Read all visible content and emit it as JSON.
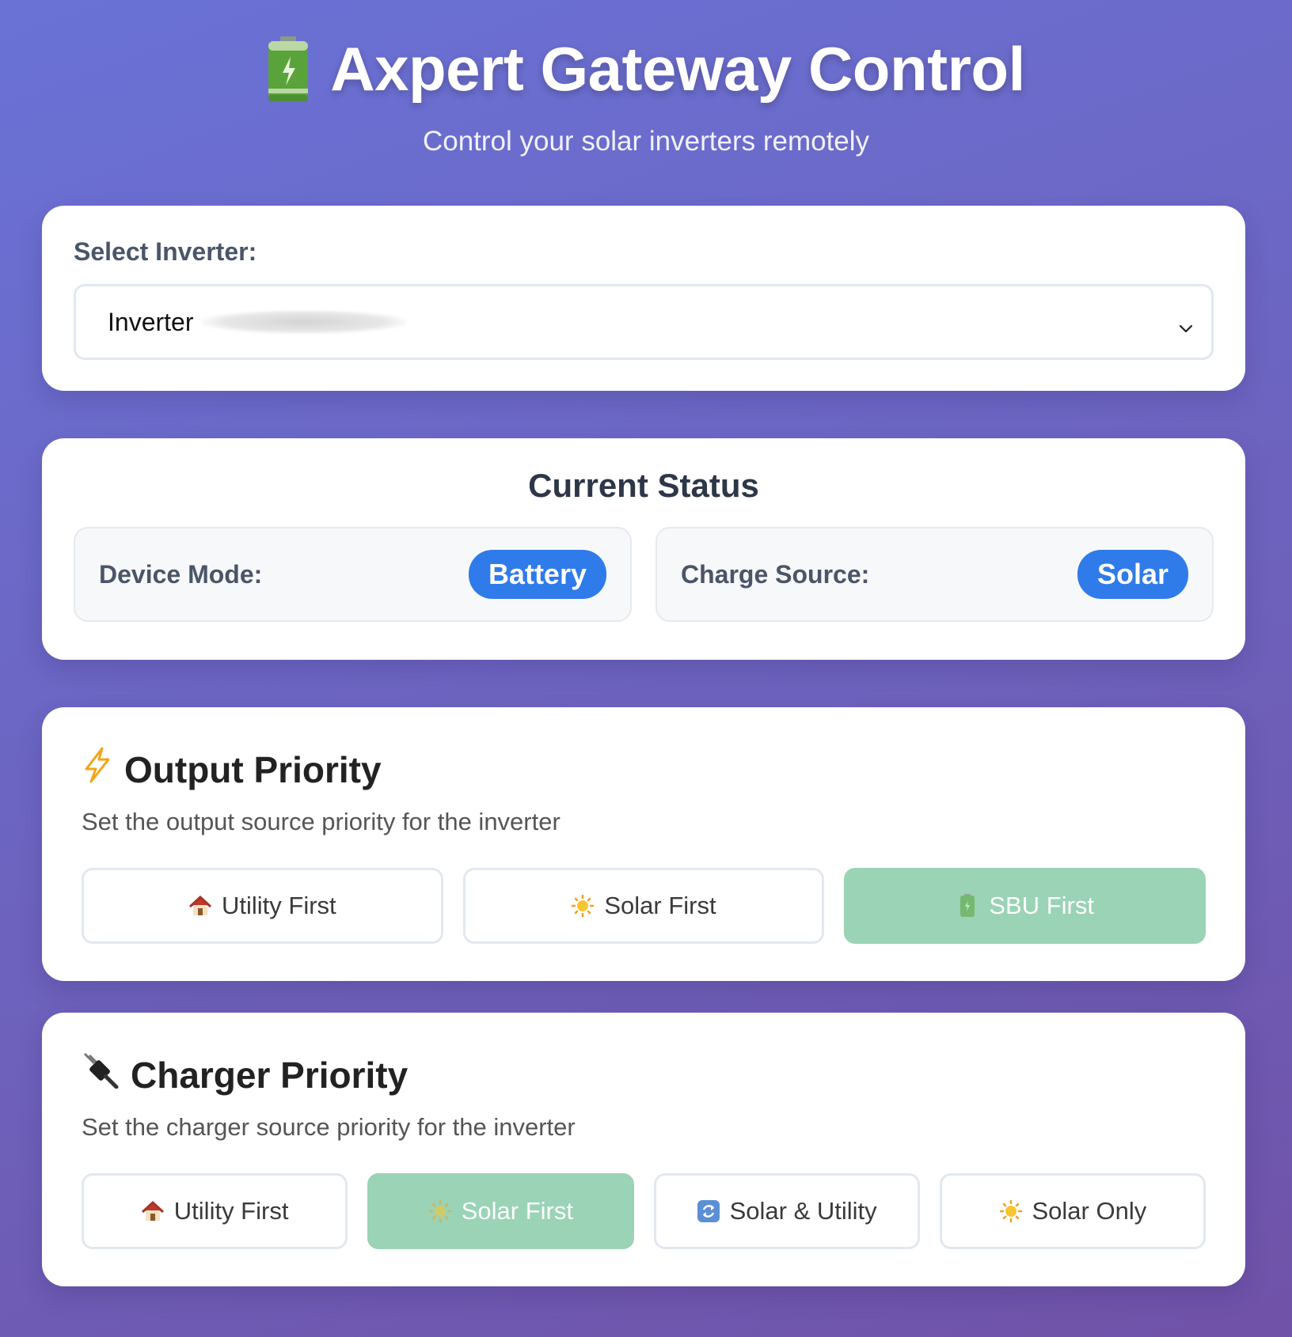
{
  "header": {
    "title": "Axpert Gateway Control",
    "subtitle": "Control your solar inverters remotely",
    "icon": "battery-icon"
  },
  "inverter_select": {
    "label": "Select Inverter:",
    "selected_value": "Inverter"
  },
  "status": {
    "title": "Current Status",
    "device_mode_label": "Device Mode:",
    "device_mode_value": "Battery",
    "charge_source_label": "Charge Source:",
    "charge_source_value": "Solar",
    "badge_color": "#2f7bea"
  },
  "output_priority": {
    "title": "Output Priority",
    "icon": "lightning-icon",
    "description": "Set the output source priority for the inverter",
    "options": [
      {
        "label": "Utility First",
        "icon": "house-icon",
        "active": false
      },
      {
        "label": "Solar First",
        "icon": "sun-icon",
        "active": false
      },
      {
        "label": "SBU First",
        "icon": "battery-icon",
        "active": true
      }
    ]
  },
  "charger_priority": {
    "title": "Charger Priority",
    "icon": "plug-icon",
    "description": "Set the charger source priority for the inverter",
    "options": [
      {
        "label": "Utility First",
        "icon": "house-icon",
        "active": false
      },
      {
        "label": "Solar First",
        "icon": "sun-icon",
        "active": true
      },
      {
        "label": "Solar & Utility",
        "icon": "cycle-icon",
        "active": false
      },
      {
        "label": "Solar Only",
        "icon": "sun-icon",
        "active": false
      }
    ]
  },
  "colors": {
    "active_button": "#9ad3b5",
    "background_start": "#6a72d6",
    "background_end": "#7052a8"
  }
}
